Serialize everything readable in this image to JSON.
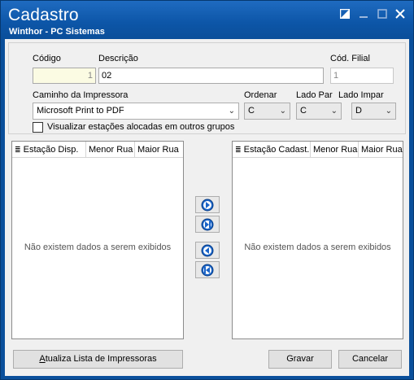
{
  "window": {
    "title": "Cadastro",
    "subtitle": "Winthor - PC Sistemas"
  },
  "fields": {
    "codigo_label": "Código",
    "codigo_value": "1",
    "descricao_label": "Descrição",
    "descricao_value": "02",
    "cod_filial_label": "Cód. Filial",
    "cod_filial_value": "1",
    "caminho_label": "Caminho da Impressora",
    "caminho_value": "Microsoft Print to PDF",
    "ordenar_label": "Ordenar",
    "ordenar_value": "C",
    "lado_par_label": "Lado Par",
    "lado_par_value": "C",
    "lado_impar_label": "Lado Impar",
    "lado_impar_value": "D",
    "visualizar_label": "Visualizar estações alocadas em outros grupos"
  },
  "left_list": {
    "columns": [
      "Estação Disp.",
      "Menor Rua",
      "Maior Rua"
    ],
    "empty_text": "Não existem dados a serem exibidos"
  },
  "right_list": {
    "columns": [
      "Estação Cadast.",
      "Menor Rua",
      "Maior Rua"
    ],
    "empty_text": "Não existem dados a serem exibidos"
  },
  "buttons": {
    "atualiza_prefix": "A",
    "atualiza_rest": "tualiza Lista de Impressoras",
    "gravar": "Gravar",
    "cancelar": "Cancelar"
  },
  "icons": {
    "move_right": "arrow-right-icon",
    "move_all_right": "arrow-right-all-icon",
    "move_left": "arrow-left-icon",
    "move_all_left": "arrow-left-all-icon"
  },
  "colors": {
    "titlebar": "#0d56a8",
    "button_icon": "#1a64c8"
  }
}
